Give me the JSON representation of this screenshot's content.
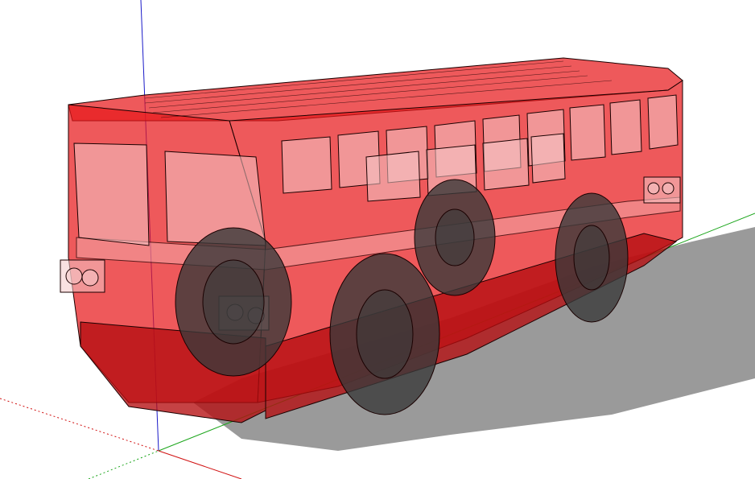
{
  "scene": {
    "subject": "bus-3d-model",
    "colors": {
      "body": "#e8191c",
      "body_dark": "#b50d10",
      "glass": "#f4c9c9",
      "wheel": "#3a3a3a",
      "shadow": "#9a9a9a",
      "axis_red": "#d11111",
      "axis_green": "#1aa51a",
      "axis_blue": "#1a1ac8",
      "edge": "#1a0000",
      "background": "#ffffff"
    }
  }
}
